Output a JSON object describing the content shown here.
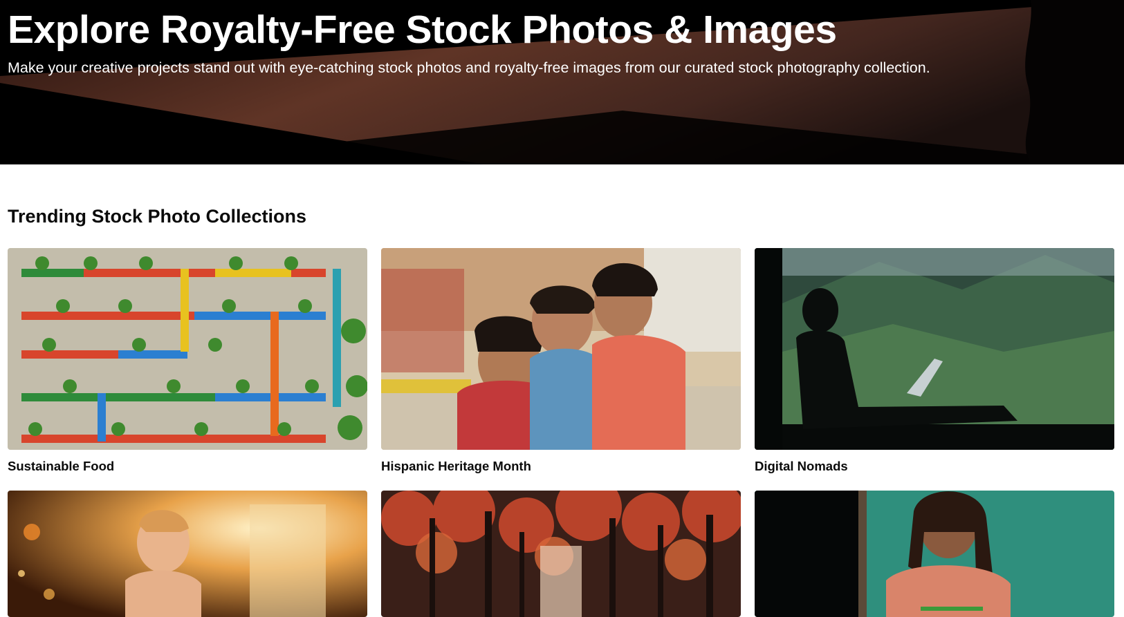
{
  "hero": {
    "title": "Explore Royalty-Free Stock Photos & Images",
    "subtitle": "Make your creative projects stand out with eye-catching stock photos and royalty-free images from our curated stock photography collection."
  },
  "section": {
    "title": "Trending Stock Photo Collections"
  },
  "collections": [
    {
      "label": "Sustainable Food",
      "image": "vertical garden with colorful pipes and potted plants"
    },
    {
      "label": "Hispanic Heritage Month",
      "image": "three smiling girls hugging"
    },
    {
      "label": "Digital Nomads",
      "image": "silhouette of woman with laptop by window overlooking mountains"
    },
    {
      "label": "",
      "image": "child in golden sunlight"
    },
    {
      "label": "",
      "image": "autumn forest with red leaves"
    },
    {
      "label": "",
      "image": "woman with long hair in front of teal wall"
    }
  ]
}
